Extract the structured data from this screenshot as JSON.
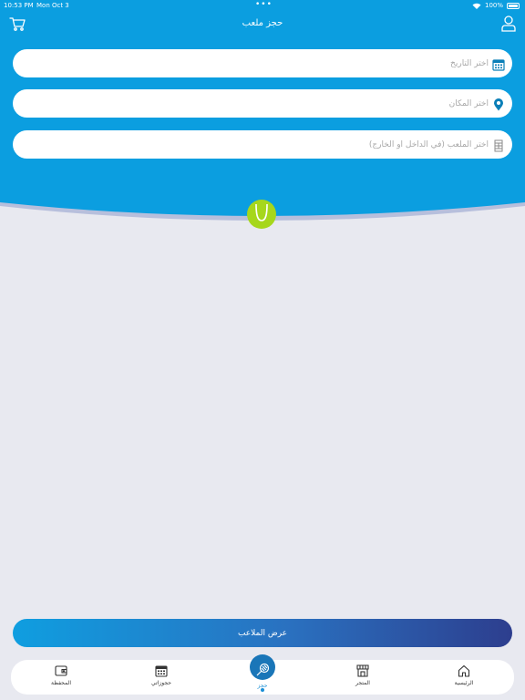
{
  "status": {
    "time": "10:53 PM",
    "date": "Mon Oct 3",
    "battery": "100%"
  },
  "header": {
    "title": "حجز ملعب",
    "background_color": "#0b9ee0"
  },
  "form": {
    "date_placeholder": "اختر التاريخ",
    "place_placeholder": "اختر المكان",
    "court_placeholder": "اختر الملعب (في الداخل او الخارج)"
  },
  "actions": {
    "show_courts_label": "عرض الملاعب"
  },
  "tabs": [
    {
      "label": "الرئيسية",
      "icon": "home-icon"
    },
    {
      "label": "المتجر",
      "icon": "store-icon"
    },
    {
      "label": "حجز",
      "icon": "racket-icon",
      "active": true
    },
    {
      "label": "حجوزاتي",
      "icon": "calendar-icon"
    },
    {
      "label": "المحفظة",
      "icon": "wallet-icon"
    }
  ],
  "colors": {
    "accent": "#1a8fd6",
    "button_gradient_start": "#0f9ee0",
    "button_gradient_end": "#2d3e8e",
    "ball": "#a6d71c"
  }
}
